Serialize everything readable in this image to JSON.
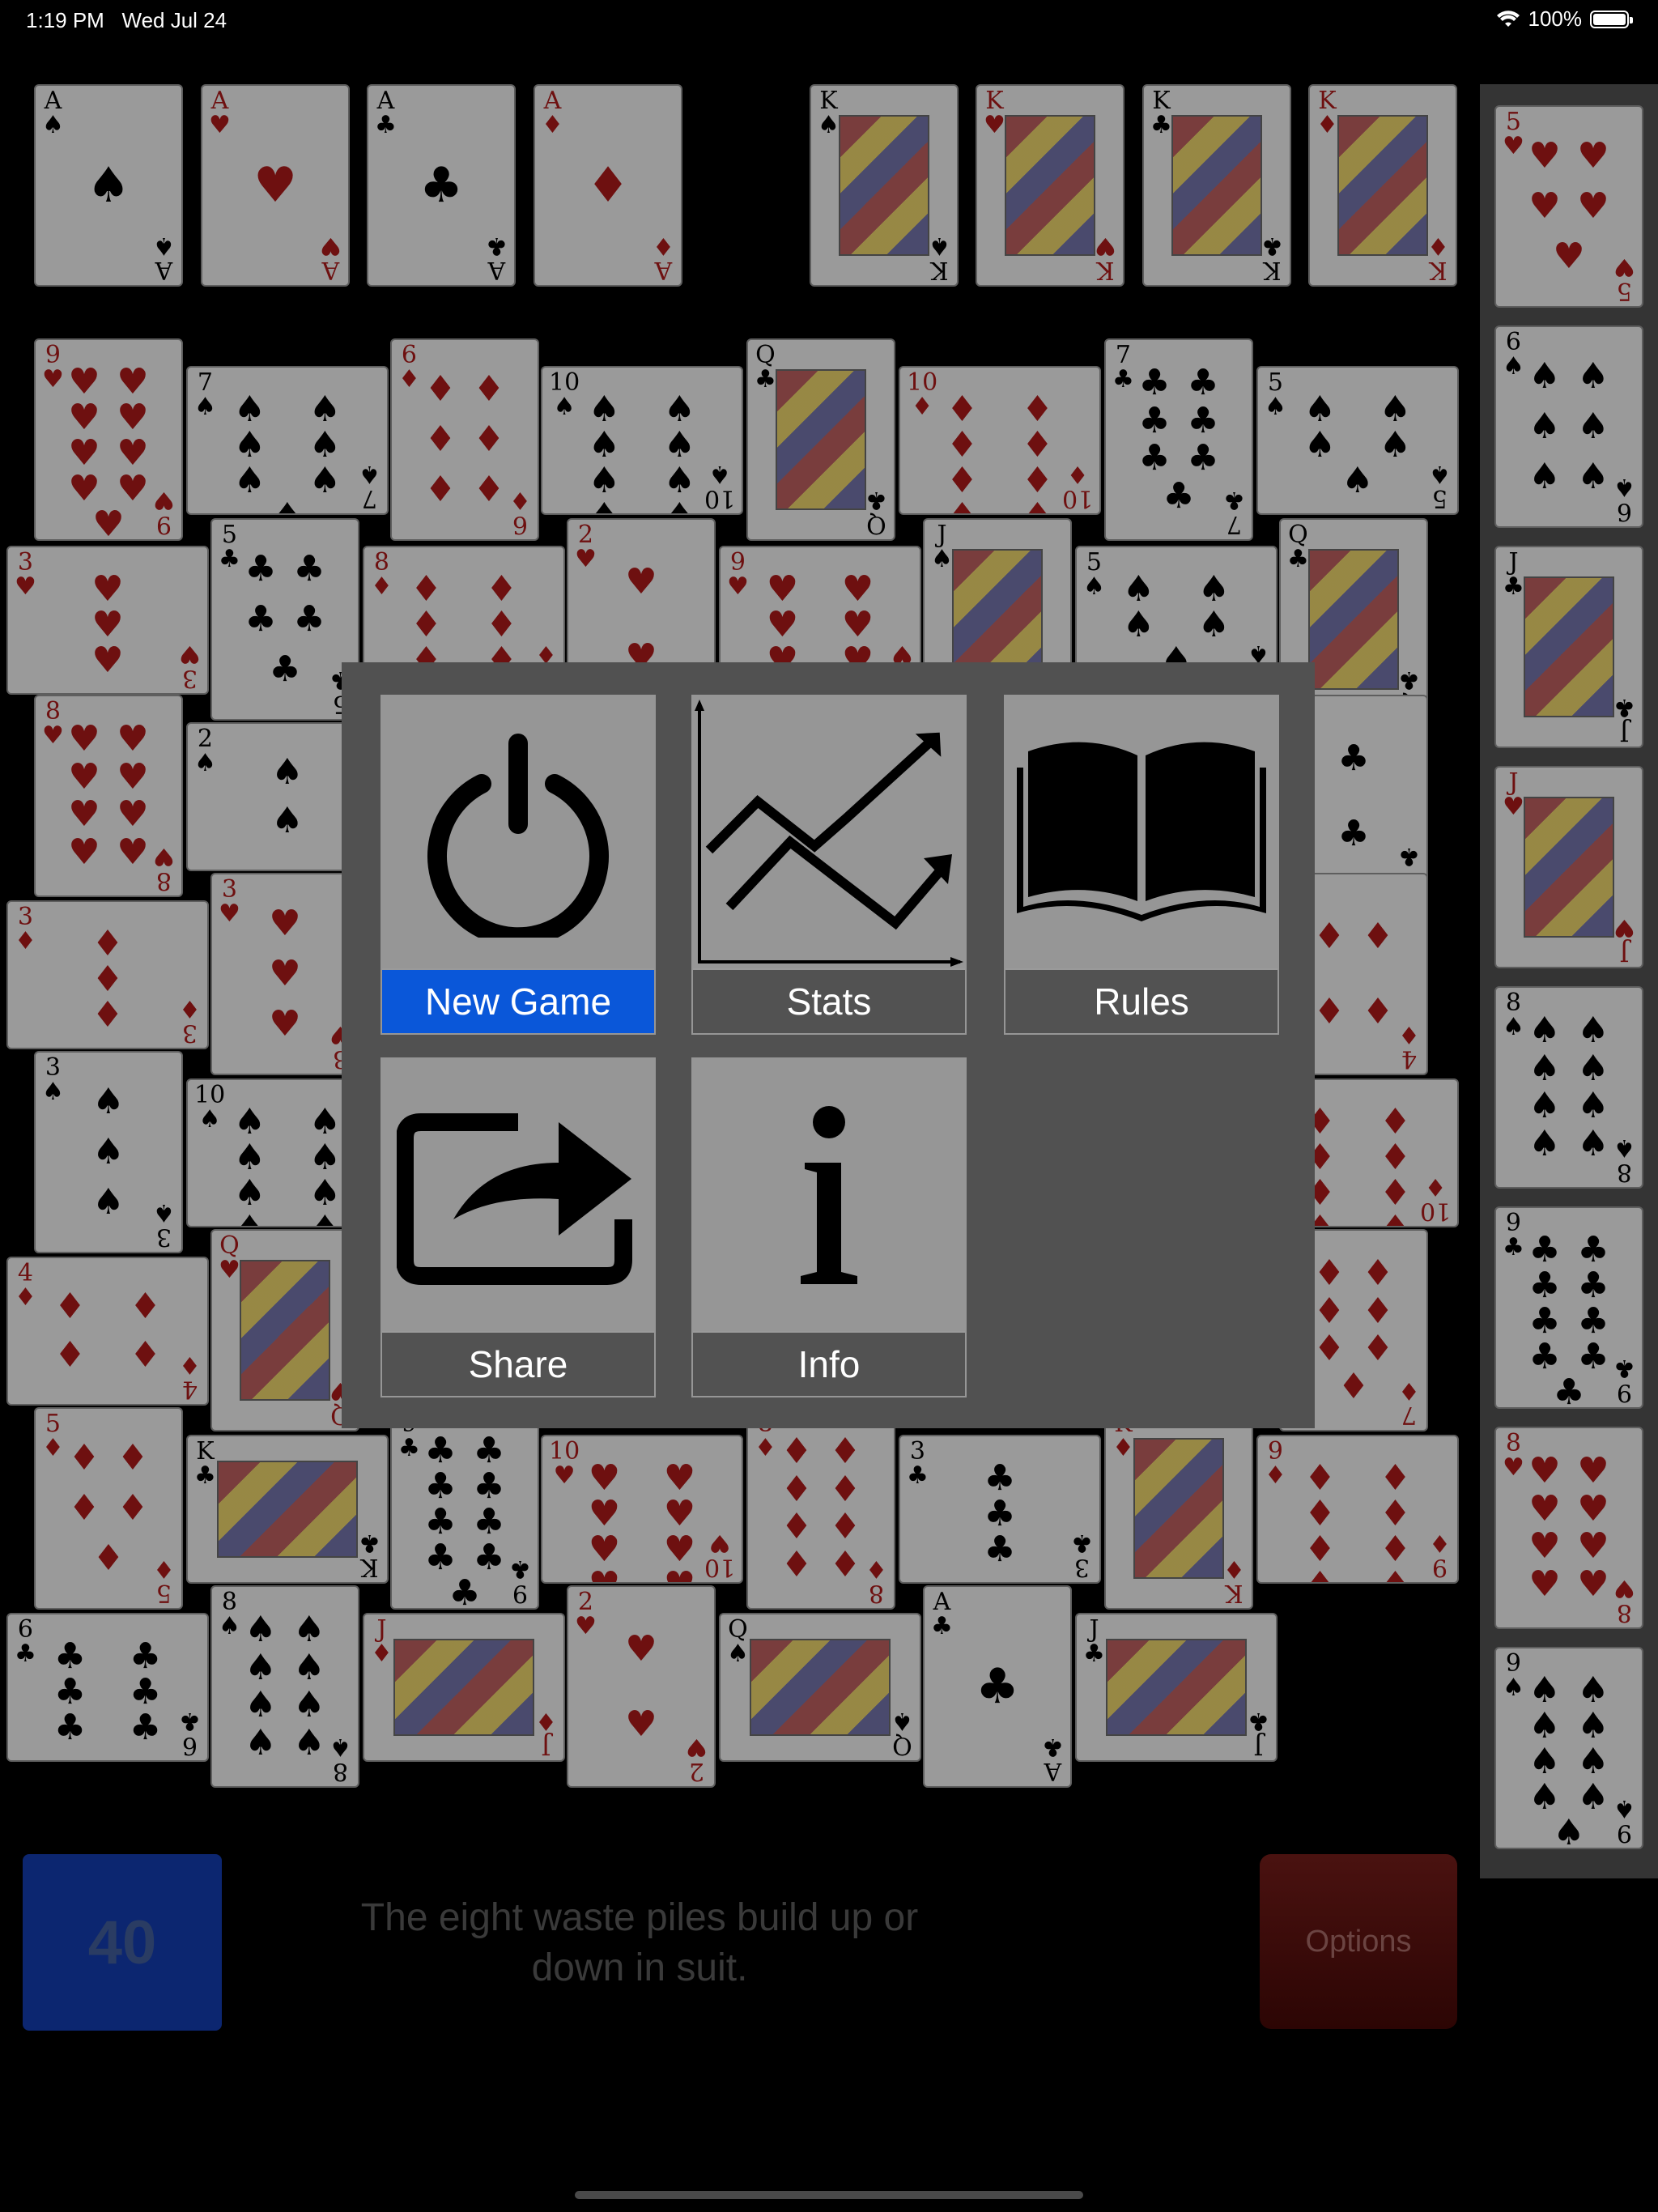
{
  "status_bar": {
    "time": "1:19 PM",
    "date": "Wed Jul 24",
    "battery_label": "100%",
    "battery_level": 1.0
  },
  "foundations": [
    {
      "rank": "A",
      "suit": "♠",
      "color": "black"
    },
    {
      "rank": "A",
      "suit": "♥",
      "color": "red"
    },
    {
      "rank": "A",
      "suit": "♣",
      "color": "black"
    },
    {
      "rank": "A",
      "suit": "♦",
      "color": "red"
    },
    {
      "rank": "K",
      "suit": "♠",
      "color": "black"
    },
    {
      "rank": "K",
      "suit": "♥",
      "color": "red"
    },
    {
      "rank": "K",
      "suit": "♣",
      "color": "black"
    },
    {
      "rank": "K",
      "suit": "♦",
      "color": "red"
    }
  ],
  "waste_piles": [
    {
      "rank": "9",
      "suit": "♥",
      "color": "red"
    },
    {
      "rank": "7",
      "suit": "♠",
      "color": "black"
    },
    {
      "rank": "6",
      "suit": "♦",
      "color": "red"
    },
    {
      "rank": "10",
      "suit": "♠",
      "color": "black"
    },
    {
      "rank": "Q",
      "suit": "♣",
      "color": "black"
    },
    {
      "rank": "10",
      "suit": "♦",
      "color": "red"
    },
    {
      "rank": "7",
      "suit": "♣",
      "color": "black"
    },
    {
      "rank": "5",
      "suit": "♠",
      "color": "black"
    },
    {
      "rank": "3",
      "suit": "♥",
      "color": "red"
    },
    {
      "rank": "5",
      "suit": "♣",
      "color": "black"
    },
    {
      "rank": "8",
      "suit": "♦",
      "color": "red"
    },
    {
      "rank": "2",
      "suit": "♥",
      "color": "red"
    },
    {
      "rank": "9",
      "suit": "♥",
      "color": "red"
    },
    {
      "rank": "J",
      "suit": "♠",
      "color": "black"
    },
    {
      "rank": "5",
      "suit": "♠",
      "color": "black"
    },
    {
      "rank": "Q",
      "suit": "♣",
      "color": "black"
    },
    {
      "rank": "8",
      "suit": "♥",
      "color": "red"
    },
    {
      "rank": "2",
      "suit": "♠",
      "color": "black"
    },
    {
      "rank": "2",
      "suit": "♣",
      "color": "black"
    },
    {
      "rank": "3",
      "suit": "♦",
      "color": "red"
    },
    {
      "rank": "3",
      "suit": "♥",
      "color": "red"
    },
    {
      "rank": "4",
      "suit": "♦",
      "color": "red"
    },
    {
      "rank": "3",
      "suit": "♠",
      "color": "black"
    },
    {
      "rank": "10",
      "suit": "♠",
      "color": "black"
    },
    {
      "rank": "10",
      "suit": "♦",
      "color": "red"
    },
    {
      "rank": "4",
      "suit": "♦",
      "color": "red"
    },
    {
      "rank": "Q",
      "suit": "♥",
      "color": "red"
    },
    {
      "rank": "7",
      "suit": "♦",
      "color": "red"
    },
    {
      "rank": "5",
      "suit": "♦",
      "color": "red"
    },
    {
      "rank": "K",
      "suit": "♣",
      "color": "black"
    },
    {
      "rank": "9",
      "suit": "♣",
      "color": "black"
    },
    {
      "rank": "10",
      "suit": "♥",
      "color": "red"
    },
    {
      "rank": "8",
      "suit": "♦",
      "color": "red"
    },
    {
      "rank": "3",
      "suit": "♣",
      "color": "black"
    },
    {
      "rank": "K",
      "suit": "♦",
      "color": "red"
    },
    {
      "rank": "9",
      "suit": "♦",
      "color": "red"
    },
    {
      "rank": "6",
      "suit": "♣",
      "color": "black"
    },
    {
      "rank": "8",
      "suit": "♠",
      "color": "black"
    },
    {
      "rank": "J",
      "suit": "♦",
      "color": "red"
    },
    {
      "rank": "2",
      "suit": "♥",
      "color": "red"
    },
    {
      "rank": "Q",
      "suit": "♠",
      "color": "black"
    },
    {
      "rank": "A",
      "suit": "♣",
      "color": "black"
    },
    {
      "rank": "J",
      "suit": "♣",
      "color": "black"
    }
  ],
  "reserve": [
    {
      "rank": "5",
      "suit": "♥",
      "color": "red"
    },
    {
      "rank": "6",
      "suit": "♠",
      "color": "black"
    },
    {
      "rank": "J",
      "suit": "♣",
      "color": "black"
    },
    {
      "rank": "J",
      "suit": "♥",
      "color": "red"
    },
    {
      "rank": "8",
      "suit": "♠",
      "color": "black"
    },
    {
      "rank": "9",
      "suit": "♣",
      "color": "black"
    },
    {
      "rank": "8",
      "suit": "♥",
      "color": "red"
    },
    {
      "rank": "9",
      "suit": "♠",
      "color": "black"
    }
  ],
  "menu": {
    "new_game": "New Game",
    "stats": "Stats",
    "rules": "Rules",
    "share": "Share",
    "info": "Info"
  },
  "bottom": {
    "score": "40",
    "tip": "The eight waste piles build up or down in suit.",
    "options": "Options"
  },
  "colors": {
    "accent": "#0a57d9",
    "score_bg": "#0c2670",
    "options_bg": "#4a1210"
  }
}
